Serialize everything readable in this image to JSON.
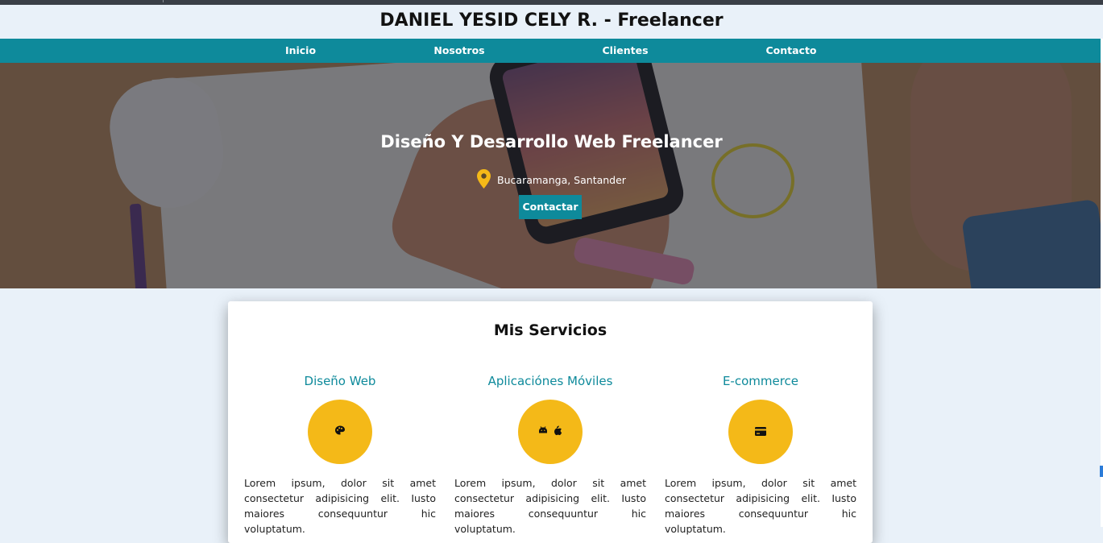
{
  "header": {
    "title": "DANIEL YESID CELY R. - Freelancer"
  },
  "nav": {
    "items": [
      "Inicio",
      "Nosotros",
      "Clientes",
      "Contacto"
    ]
  },
  "hero": {
    "title": "Diseño Y Desarrollo Web Freelancer",
    "location": "Bucaramanga, Santander",
    "button": "Contactar",
    "location_icon": "map-pin-icon"
  },
  "services": {
    "title": "Mis Servicios",
    "items": [
      {
        "title": "Diseño Web",
        "icon": "palette-icon",
        "text": "Lorem ipsum, dolor sit amet consectetur adipisicing elit. Iusto maiores consequuntur hic voluptatum."
      },
      {
        "title": "Aplicaciónes Móviles",
        "icon": "android-apple-icon",
        "text": "Lorem ipsum, dolor sit amet consectetur adipisicing elit. Iusto maiores consequuntur hic voluptatum."
      },
      {
        "title": "E-commerce",
        "icon": "credit-card-icon",
        "text": "Lorem ipsum, dolor sit amet consectetur adipisicing elit. Iusto maiores consequuntur hic voluptatum."
      }
    ]
  },
  "colors": {
    "accent": "#0e8a9b",
    "icon_circle": "#f4b918",
    "background": "#e9f1f9"
  }
}
